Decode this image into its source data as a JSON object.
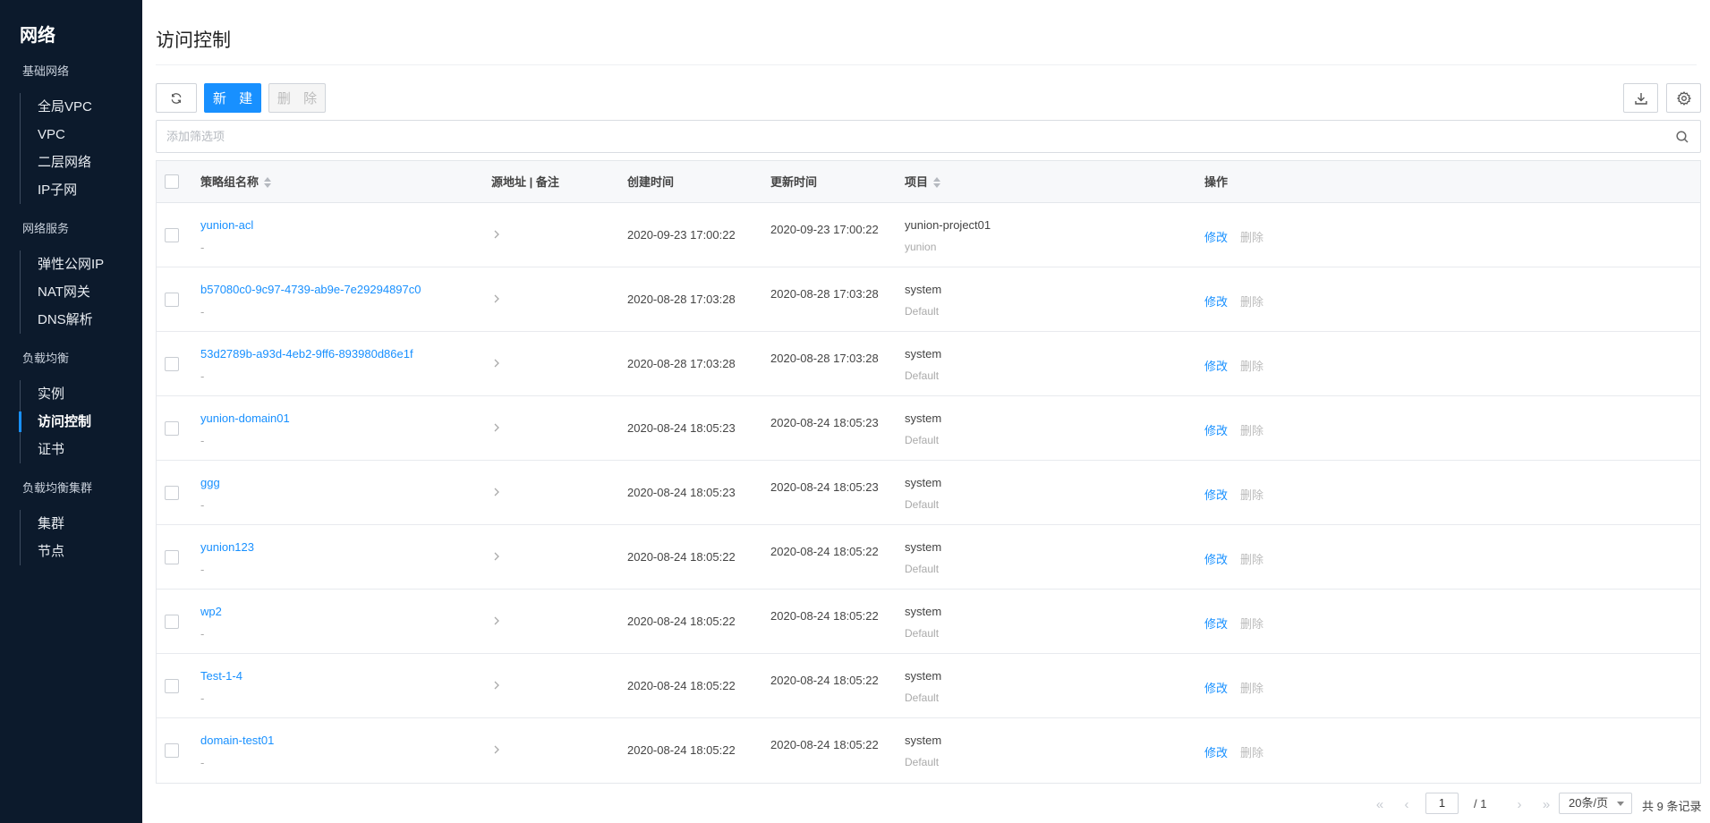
{
  "sidebar": {
    "title": "网络",
    "groups": [
      {
        "title": "基础网络",
        "items": [
          "全局VPC",
          "VPC",
          "二层网络",
          "IP子网"
        ]
      },
      {
        "title": "网络服务",
        "items": [
          "弹性公网IP",
          "NAT网关",
          "DNS解析"
        ]
      },
      {
        "title": "负载均衡",
        "items": [
          "实例",
          "访问控制",
          "证书"
        ]
      },
      {
        "title": "负载均衡集群",
        "items": [
          "集群",
          "节点"
        ]
      }
    ],
    "active_item": "访问控制"
  },
  "page": {
    "title": "访问控制"
  },
  "toolbar": {
    "new_label": "新 建",
    "delete_label": "删 除"
  },
  "filter": {
    "placeholder": "添加筛选项"
  },
  "table": {
    "columns": {
      "name": "策略组名称",
      "source": "源地址 | 备注",
      "created": "创建时间",
      "updated": "更新时间",
      "project": "项目",
      "actions": "操作"
    },
    "rows": [
      {
        "name": "yunion-acl",
        "remark": "-",
        "created": "2020-09-23 17:00:22",
        "updated": "2020-09-23 17:00:22",
        "project": "yunion-project01",
        "domain": "yunion",
        "edit": "修改",
        "delete": "删除"
      },
      {
        "name": "b57080c0-9c97-4739-ab9e-7e29294897c0",
        "remark": "-",
        "created": "2020-08-28 17:03:28",
        "updated": "2020-08-28 17:03:28",
        "project": "system",
        "domain": "Default",
        "edit": "修改",
        "delete": "删除"
      },
      {
        "name": "53d2789b-a93d-4eb2-9ff6-893980d86e1f",
        "remark": "-",
        "created": "2020-08-28 17:03:28",
        "updated": "2020-08-28 17:03:28",
        "project": "system",
        "domain": "Default",
        "edit": "修改",
        "delete": "删除"
      },
      {
        "name": "yunion-domain01",
        "remark": "-",
        "created": "2020-08-24 18:05:23",
        "updated": "2020-08-24 18:05:23",
        "project": "system",
        "domain": "Default",
        "edit": "修改",
        "delete": "删除"
      },
      {
        "name": "ggg",
        "remark": "-",
        "created": "2020-08-24 18:05:23",
        "updated": "2020-08-24 18:05:23",
        "project": "system",
        "domain": "Default",
        "edit": "修改",
        "delete": "删除"
      },
      {
        "name": "yunion123",
        "remark": "-",
        "created": "2020-08-24 18:05:22",
        "updated": "2020-08-24 18:05:22",
        "project": "system",
        "domain": "Default",
        "edit": "修改",
        "delete": "删除"
      },
      {
        "name": "wp2",
        "remark": "-",
        "created": "2020-08-24 18:05:22",
        "updated": "2020-08-24 18:05:22",
        "project": "system",
        "domain": "Default",
        "edit": "修改",
        "delete": "删除"
      },
      {
        "name": "Test-1-4",
        "remark": "-",
        "created": "2020-08-24 18:05:22",
        "updated": "2020-08-24 18:05:22",
        "project": "system",
        "domain": "Default",
        "edit": "修改",
        "delete": "删除"
      },
      {
        "name": "domain-test01",
        "remark": "-",
        "created": "2020-08-24 18:05:22",
        "updated": "2020-08-24 18:05:22",
        "project": "system",
        "domain": "Default",
        "edit": "修改",
        "delete": "删除"
      }
    ]
  },
  "pagination": {
    "current_page": "1",
    "total_pages": "/ 1",
    "page_size": "20条/页",
    "total": "共 9 条记录"
  },
  "colors": {
    "primary": "#1890ff",
    "sidebar_bg": "#0c1a2c"
  }
}
